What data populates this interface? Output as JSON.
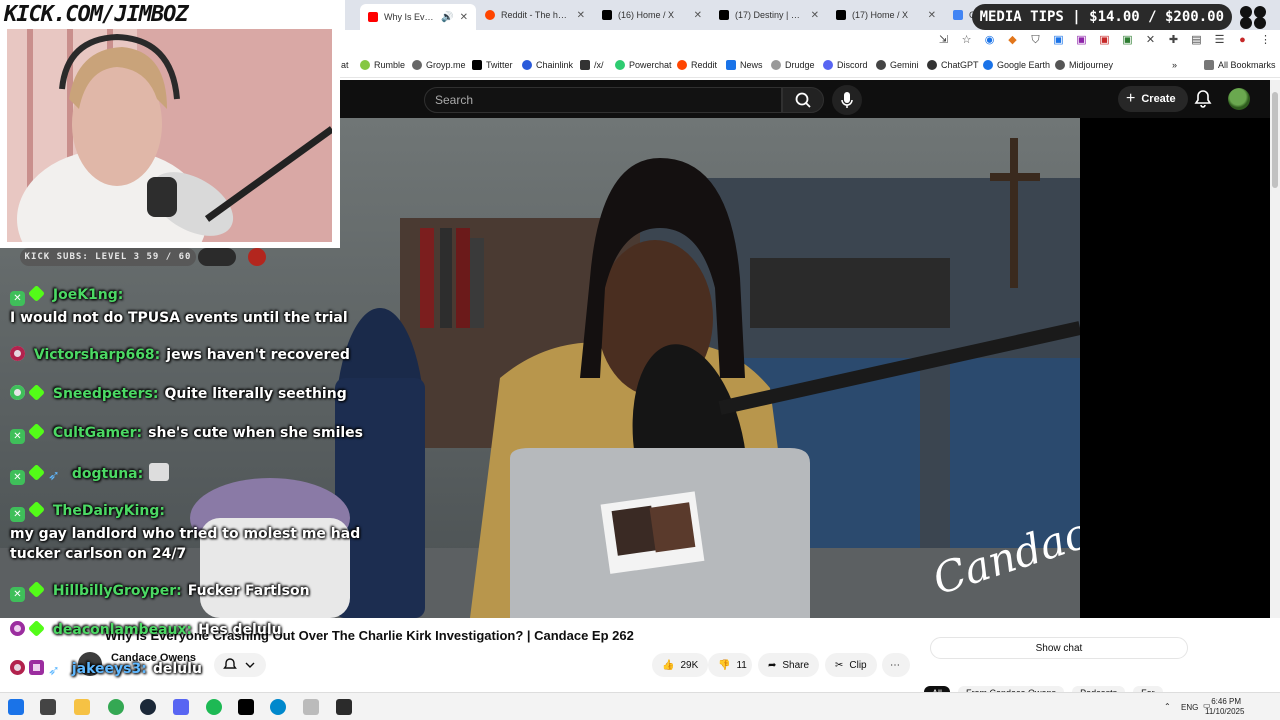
{
  "browser": {
    "tabs": [
      {
        "title": "Why Is Everyone",
        "active": true
      },
      {
        "title": "Reddit - The heart c"
      },
      {
        "title": "(16) Home / X"
      },
      {
        "title": "(17) Destiny | Steve"
      },
      {
        "title": "(17) Home / X"
      },
      {
        "title": "G"
      }
    ],
    "bookmarks": [
      "at",
      "Rumble",
      "Groyp.me",
      "Twitter",
      "Chainlink",
      "/x/",
      "Powerchat",
      "Reddit",
      "News",
      "Drudge",
      "Discord",
      "Gemini",
      "ChatGPT",
      "Google Earth",
      "Midjourney"
    ],
    "all_bookmarks": "All Bookmarks"
  },
  "overlay": {
    "kick_banner": "KICK.COM/JIMBOZ",
    "media_tips": "MEDIA TIPS | $14.00 / $200.00",
    "kick_subs": "KICK SUBS: LEVEL 3 59 / 60",
    "chat": [
      {
        "user": "JoeK1ng:",
        "text": "I would not do TPUSA events until the trial",
        "badges": [
          "x",
          "d"
        ]
      },
      {
        "user": "Victorsharp668:",
        "text": "jews haven't recovered",
        "badges": [
          "r"
        ]
      },
      {
        "user": "Sneedpeters:",
        "text": "Quite literally seething",
        "badges": [
          "g",
          "d"
        ]
      },
      {
        "user": "CultGamer:",
        "text": "she's cute when she smiles",
        "badges": [
          "x",
          "d"
        ]
      },
      {
        "user": "dogtuna:",
        "text": "",
        "badges": [
          "x",
          "d",
          "s"
        ]
      },
      {
        "user": "TheDairyKing:",
        "text": "my gay landlord who tried to molest me had",
        "text2": "tucker carlson on 24/7",
        "badges": [
          "x",
          "d"
        ]
      },
      {
        "user": "HillbillyGroyper:",
        "text": "Fucker Fartlson",
        "badges": [
          "x",
          "d"
        ]
      },
      {
        "user": "deaconlambeaux:",
        "text": "Hes delulu",
        "badges": [
          "p",
          "d"
        ]
      },
      {
        "user": "jakeeys3:",
        "text": "delulu",
        "badges": [
          "r",
          "p",
          "s"
        ]
      }
    ]
  },
  "youtube": {
    "search_placeholder": "Search",
    "create_label": "Create",
    "video_signature": "Candace",
    "video_title": "Why Is Everyone Crashing Out Over The Charlie Kirk Investigation? | Candace Ep 262",
    "channel_name": "Candace Owens",
    "likes": "29K",
    "dislikes": "11",
    "share_label": "Share",
    "clip_label": "Clip",
    "show_chat": "Show chat",
    "chips": [
      "All",
      "From Candace Owens",
      "Podcasts",
      "For"
    ]
  },
  "taskbar": {
    "time": "6:46 PM",
    "date": "11/10/2025",
    "lang": "ENG"
  }
}
